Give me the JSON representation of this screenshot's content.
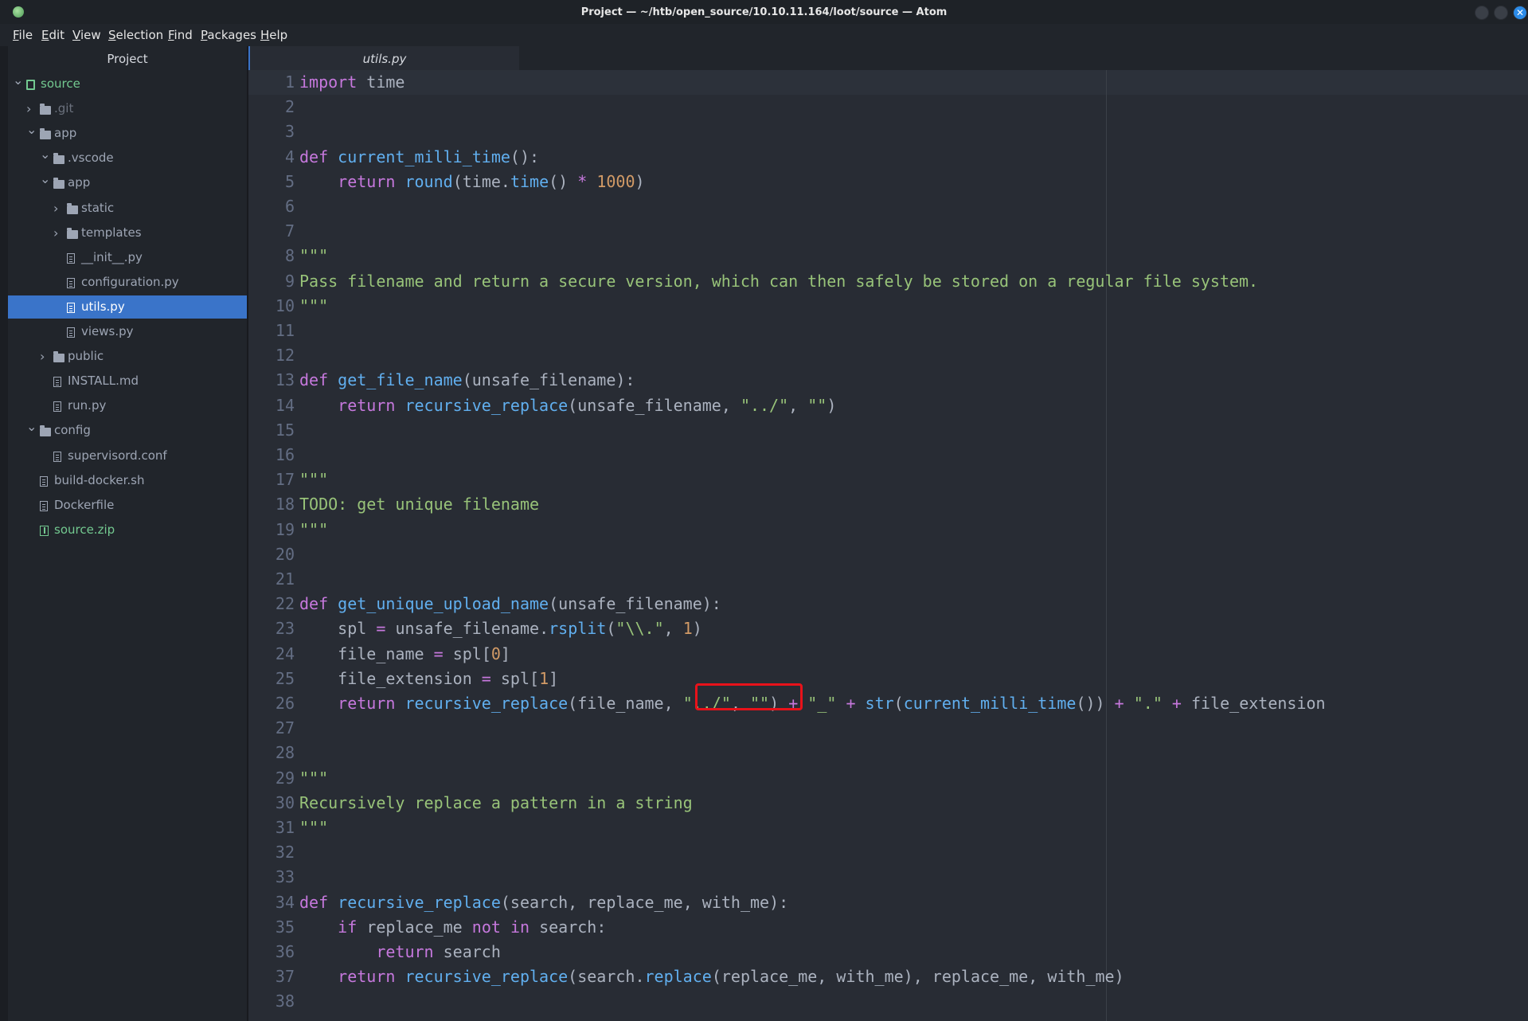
{
  "window": {
    "title": "Project — ~/htb/open_source/10.10.11.164/loot/source — Atom"
  },
  "menu": {
    "file": {
      "first": "F",
      "rest": "ile"
    },
    "edit": {
      "first": "E",
      "rest": "dit"
    },
    "view": {
      "first": "V",
      "rest": "iew"
    },
    "selection": {
      "first": "S",
      "rest": "election"
    },
    "find": {
      "first": "F",
      "rest": "ind"
    },
    "packages": {
      "first": "P",
      "rest": "ackages"
    },
    "help": {
      "first": "H",
      "rest": "elp"
    }
  },
  "sidebar": {
    "tab_label": "Project",
    "tree": [
      {
        "label": "source",
        "type": "repo",
        "expanded": true
      },
      {
        "label": ".git",
        "type": "folder",
        "expanded": false
      },
      {
        "label": "app",
        "type": "folder",
        "expanded": true
      },
      {
        "label": ".vscode",
        "type": "folder",
        "expanded": true
      },
      {
        "label": "app",
        "type": "folder",
        "expanded": true
      },
      {
        "label": "static",
        "type": "folder",
        "expanded": false
      },
      {
        "label": "templates",
        "type": "folder",
        "expanded": false
      },
      {
        "label": "__init__.py",
        "type": "file"
      },
      {
        "label": "configuration.py",
        "type": "file"
      },
      {
        "label": "utils.py",
        "type": "file",
        "selected": true
      },
      {
        "label": "views.py",
        "type": "file"
      },
      {
        "label": "public",
        "type": "folder",
        "expanded": false
      },
      {
        "label": "INSTALL.md",
        "type": "file"
      },
      {
        "label": "run.py",
        "type": "file"
      },
      {
        "label": "config",
        "type": "folder",
        "expanded": true
      },
      {
        "label": "supervisord.conf",
        "type": "file"
      },
      {
        "label": "build-docker.sh",
        "type": "file"
      },
      {
        "label": "Dockerfile",
        "type": "file"
      },
      {
        "label": "source.zip",
        "type": "zip"
      }
    ]
  },
  "editor": {
    "active_tab": "utils.py",
    "lines": [
      {
        "n": "1",
        "text": "import time"
      },
      {
        "n": "2",
        "text": ""
      },
      {
        "n": "3",
        "text": ""
      },
      {
        "n": "4",
        "text": "def current_milli_time():"
      },
      {
        "n": "5",
        "text": "    return round(time.time() * 1000)"
      },
      {
        "n": "6",
        "text": ""
      },
      {
        "n": "7",
        "text": ""
      },
      {
        "n": "8",
        "text": "\"\"\""
      },
      {
        "n": "9",
        "text": "Pass filename and return a secure version, which can then safely be stored on a regular file system."
      },
      {
        "n": "10",
        "text": "\"\"\""
      },
      {
        "n": "11",
        "text": ""
      },
      {
        "n": "12",
        "text": ""
      },
      {
        "n": "13",
        "text": "def get_file_name(unsafe_filename):"
      },
      {
        "n": "14",
        "text": "    return recursive_replace(unsafe_filename, \"../\", \"\")"
      },
      {
        "n": "15",
        "text": ""
      },
      {
        "n": "16",
        "text": ""
      },
      {
        "n": "17",
        "text": "\"\"\""
      },
      {
        "n": "18",
        "text": "TODO: get unique filename"
      },
      {
        "n": "19",
        "text": "\"\"\""
      },
      {
        "n": "20",
        "text": ""
      },
      {
        "n": "21",
        "text": ""
      },
      {
        "n": "22",
        "text": "def get_unique_upload_name(unsafe_filename):"
      },
      {
        "n": "23",
        "text": "    spl = unsafe_filename.rsplit(\"\\\\.\", 1)"
      },
      {
        "n": "24",
        "text": "    file_name = spl[0]"
      },
      {
        "n": "25",
        "text": "    file_extension = spl[1]"
      },
      {
        "n": "26",
        "text": "    return recursive_replace(file_name, \"../\", \"\") + \"_\" + str(current_milli_time()) + \".\" + file_extension"
      },
      {
        "n": "27",
        "text": ""
      },
      {
        "n": "28",
        "text": ""
      },
      {
        "n": "29",
        "text": "\"\"\""
      },
      {
        "n": "30",
        "text": "Recursively replace a pattern in a string"
      },
      {
        "n": "31",
        "text": "\"\"\""
      },
      {
        "n": "32",
        "text": ""
      },
      {
        "n": "33",
        "text": ""
      },
      {
        "n": "34",
        "text": "def recursive_replace(search, replace_me, with_me):"
      },
      {
        "n": "35",
        "text": "    if replace_me not in search:"
      },
      {
        "n": "36",
        "text": "        return search"
      },
      {
        "n": "37",
        "text": "    return recursive_replace(search.replace(replace_me, with_me), replace_me, with_me)"
      },
      {
        "n": "38",
        "text": ""
      }
    ]
  },
  "colors": {
    "keyword": "#c678dd",
    "function": "#61afef",
    "string": "#98c379",
    "number": "#d19a66",
    "selection": "#3a74c9",
    "annotation_box": "#e8121a"
  }
}
